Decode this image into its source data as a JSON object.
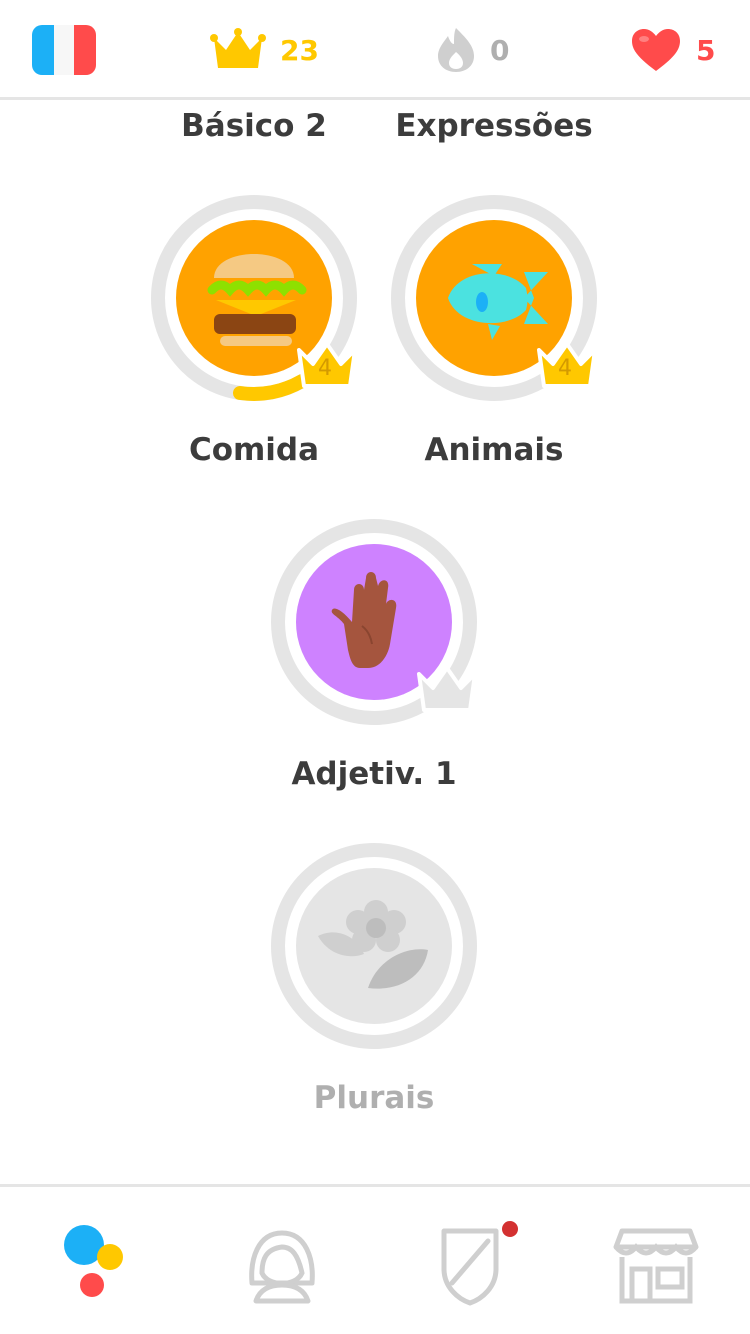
{
  "status_bar": {
    "language_flag": "french-flag-icon",
    "crowns": {
      "icon": "crown-icon",
      "count": "23",
      "color": "#FFC800"
    },
    "streak": {
      "icon": "streak-flame-icon",
      "count": "0",
      "color": "#AFAFAF"
    },
    "hearts": {
      "icon": "heart-icon",
      "count": "5",
      "color": "#FF4B4B"
    }
  },
  "tree": {
    "top_row_labels": [
      "Básico 2",
      "Expressões"
    ],
    "skills": [
      {
        "label": "Comida",
        "icon": "burger-icon",
        "crown_level": "4",
        "color": "#FFA200"
      },
      {
        "label": "Animais",
        "icon": "fish-icon",
        "crown_level": "4",
        "color": "#FFA200"
      },
      {
        "label": "Adjetiv. 1",
        "icon": "hand-icon",
        "crown_level": "",
        "color": "#CE82FF"
      },
      {
        "label": "Plurais",
        "icon": "flower-icon",
        "crown_level": "",
        "color": "#E5E5E5"
      }
    ]
  },
  "bottom_nav": [
    {
      "name": "learn-tab",
      "icon": "learn-dots-icon"
    },
    {
      "name": "profile-tab",
      "icon": "profile-icon"
    },
    {
      "name": "leagues-tab",
      "icon": "shield-icon",
      "notification": true
    },
    {
      "name": "shop-tab",
      "icon": "shop-icon"
    }
  ]
}
